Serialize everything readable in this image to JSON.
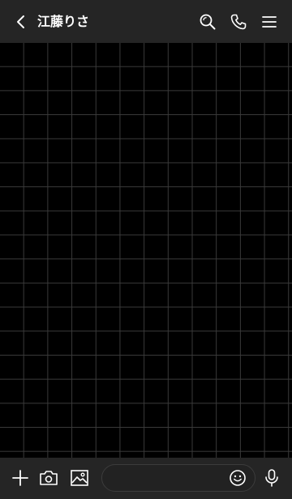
{
  "header": {
    "title": "江藤りさ",
    "icons": {
      "back": "chevron-left-icon",
      "search": "search-icon",
      "call": "phone-icon",
      "menu": "menu-icon"
    }
  },
  "footer": {
    "input_value": "",
    "icons": {
      "add": "plus-icon",
      "camera": "camera-icon",
      "image": "image-icon",
      "emoji": "smiley-icon",
      "voice": "microphone-icon"
    }
  },
  "colors": {
    "bar_background": "#252525",
    "chat_background": "#000000",
    "grid_lines": "#3a3a3a",
    "icon": "#ffffff"
  }
}
